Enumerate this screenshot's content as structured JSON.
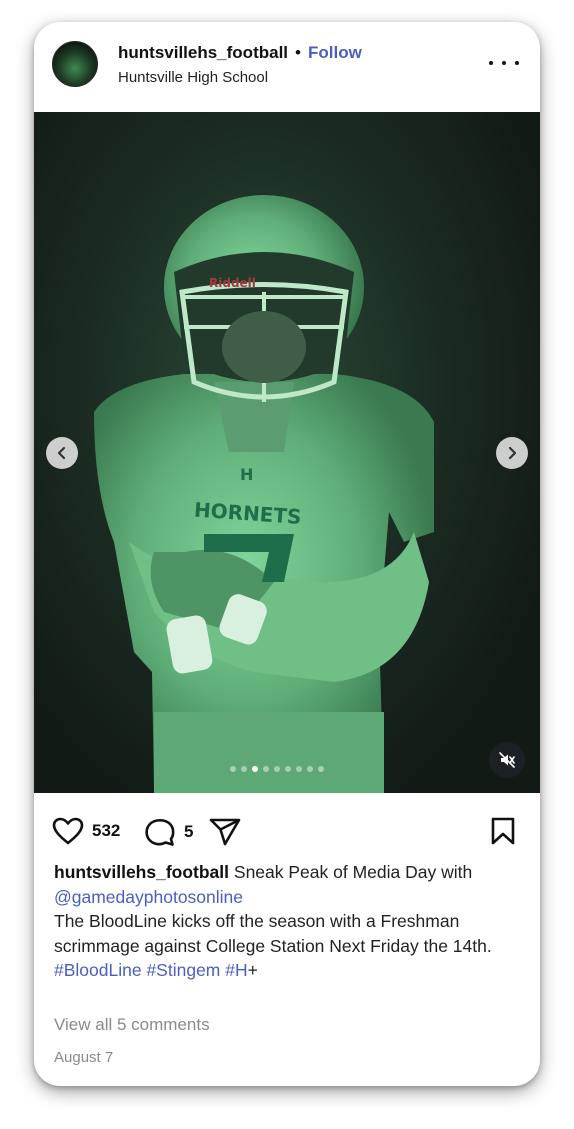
{
  "post": {
    "username": "huntsvillehs_football",
    "separator": "•",
    "follow_label": "Follow",
    "location": "Huntsville High School",
    "more_icon": "more-horizontal-icon"
  },
  "media": {
    "slide_count": 9,
    "active_slide": 3,
    "prev_icon": "chevron-left-icon",
    "next_icon": "chevron-right-icon",
    "mute_icon": "muted-speaker-icon"
  },
  "actions": {
    "likes": "532",
    "comments": "5"
  },
  "caption": {
    "username": "huntsvillehs_football",
    "text_start": " Sneak Peak of Media Day with ",
    "mention": "@gamedayphotosonline",
    "body": "The BloodLine kicks off the season with a Freshman scrimmage against College Station Next Friday the 14th.",
    "hashtags": [
      "#BloodLine",
      "#Stingem",
      "#H"
    ],
    "suffix": "+"
  },
  "view_comments": "View all 5 comments",
  "date": "August 7",
  "colors": {
    "link": "#4a5fc1",
    "muted_text": "#8a8a8a",
    "photo_tint": "#2a4a36"
  }
}
